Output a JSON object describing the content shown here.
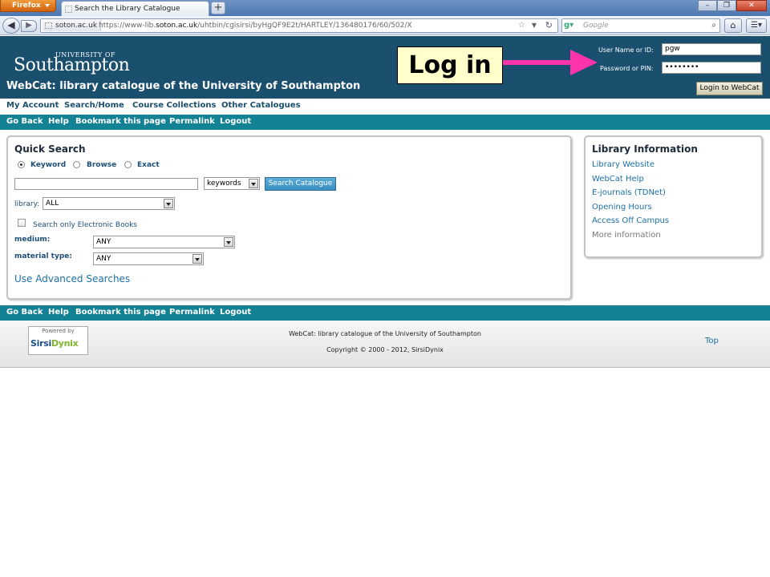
{
  "browser": {
    "app_button": "Firefox",
    "tab_title": "Search the Library Catalogue",
    "new_tab": "+",
    "url_site": "soton.ac.uk",
    "url_prefix": "https://www-lib.",
    "url_domain": "soton.ac.uk",
    "url_path": "/uhtbin/cgisirsi/byHgQF9E2t/HARTLEY/136480176/60/502/X",
    "search_placeholder": "Google"
  },
  "header": {
    "logo_small": "UNIVERSITY OF",
    "logo_big": "Southampton",
    "title": "WebCat: library catalogue of the University of Southampton",
    "user_label": "User Name or ID:",
    "user_value": "pgw",
    "pin_label": "Password or PIN:",
    "pin_value": "••••••••",
    "login_button": "Login to WebCat"
  },
  "annotation": {
    "text": "Log in",
    "arrow_color": "#ff33aa"
  },
  "menu_primary": [
    "My Account",
    "Search/Home",
    "Course Collections",
    "Other Catalogues"
  ],
  "menu_secondary": [
    "Go Back",
    "Help",
    "Bookmark this page",
    "Permalink",
    "Logout"
  ],
  "quick_search": {
    "heading": "Quick Search",
    "radios": [
      {
        "label": "Keyword",
        "selected": true
      },
      {
        "label": "Browse",
        "selected": false
      },
      {
        "label": "Exact",
        "selected": false
      }
    ],
    "search_value": "",
    "search_type": "keywords",
    "search_button": "Search Catalogue",
    "library_label": "library:",
    "library_value": "ALL",
    "ebooks_label": "Search only Electronic Books",
    "medium_label": "medium:",
    "medium_value": "ANY",
    "material_label": "material type:",
    "material_value": "ANY",
    "advanced_link": "Use Advanced Searches"
  },
  "library_info": {
    "heading": "Library Information",
    "links": [
      "Library Website",
      "WebCat Help",
      "E-journals (TDNet)",
      "Opening Hours",
      "Access Off Campus",
      "More information"
    ]
  },
  "footer": {
    "powered_by": "Powered by",
    "sirsi": "Sirsi",
    "dynix": "Dynix",
    "line1": "WebCat: library catalogue of the University of Southampton",
    "line2": "Copyright © 2000 - 2012, SirsiDynix",
    "top_link": "Top"
  },
  "colors": {
    "header_bg": "#1b4f6e",
    "menu_bar": "#128294",
    "link": "#1d6fa5"
  }
}
